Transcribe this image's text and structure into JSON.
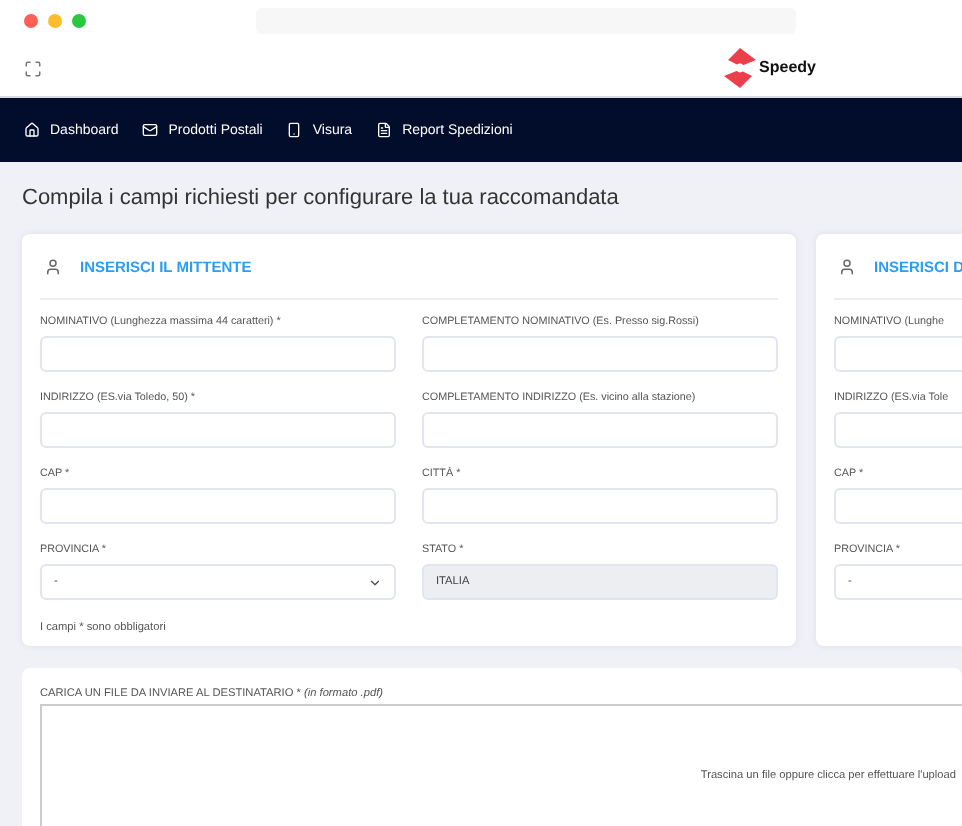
{
  "header": {
    "logo_text": "Speedy"
  },
  "nav": [
    {
      "label": "Dashboard"
    },
    {
      "label": "Prodotti Postali"
    },
    {
      "label": "Visura"
    },
    {
      "label": "Report Spedizioni"
    }
  ],
  "page_title": "Compila i campi richiesti per configurare la tua raccomandata",
  "sender": {
    "title": "INSERISCI IL MITTENTE",
    "fields": [
      {
        "label": "NOMINATIVO (Lunghezza massima 44 caratteri) *",
        "kind": "text"
      },
      {
        "label": "COMPLETAMENTO NOMINATIVO (Es. Presso sig.Rossi)",
        "kind": "text"
      },
      {
        "label": "INDIRIZZO (ES.via Toledo, 50) *",
        "kind": "text"
      },
      {
        "label": "COMPLETAMENTO INDIRIZZO (Es. vicino alla stazione)",
        "kind": "text"
      },
      {
        "label": "CAP *",
        "kind": "text"
      },
      {
        "label": "CITTÀ *",
        "kind": "text"
      },
      {
        "label": "PROVINCIA *",
        "kind": "select",
        "value": "-",
        "arrow": true
      },
      {
        "label": "STATO *",
        "kind": "disabled",
        "value": "ITALIA"
      }
    ],
    "note": "I campi * sono obbligatori"
  },
  "recipient": {
    "title": "INSERISCI D",
    "fields": [
      {
        "label": "NOMINATIVO (Lunghe",
        "kind": "text"
      },
      {
        "label": "INDIRIZZO (ES.via Tole",
        "kind": "text"
      },
      {
        "label": "CAP *",
        "kind": "text"
      },
      {
        "label": "PROVINCIA *",
        "kind": "select",
        "value": "-"
      }
    ]
  },
  "upload": {
    "label": "CARICA UN FILE DA INVIARE AL DESTINATARIO * *(in formato .pdf)*",
    "hint": "Trascina un file oppure clicca per effettuare l'upload"
  }
}
